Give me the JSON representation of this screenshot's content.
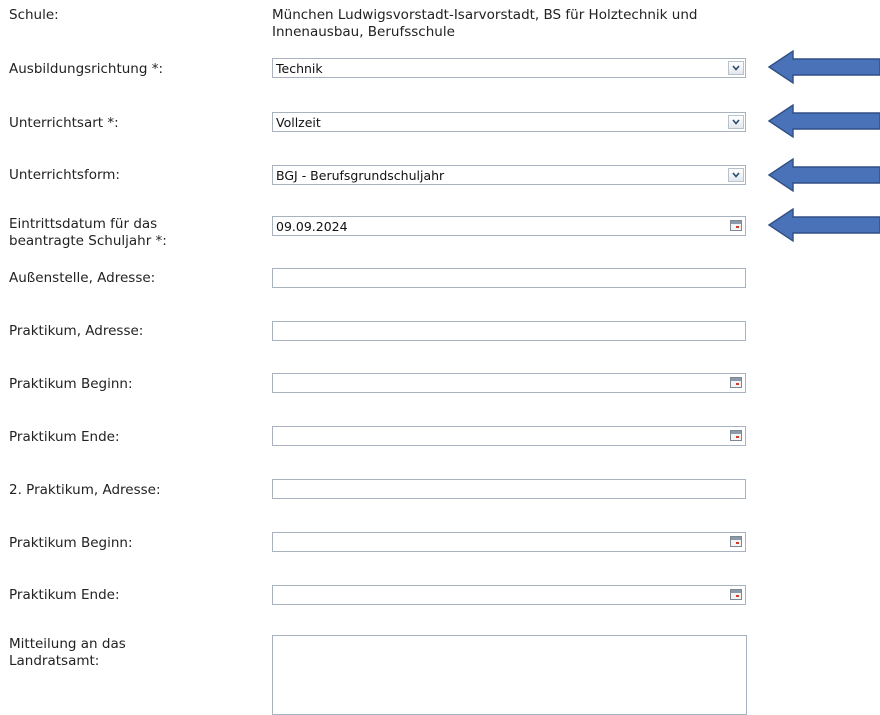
{
  "form": {
    "schule": {
      "label": "Schule:",
      "value_line1": "München Ludwigsvorstadt-Isarvorstadt, BS für Holztechnik und",
      "value_line2": "Innenausbau, Berufsschule"
    },
    "ausbildungsrichtung": {
      "label": "Ausbildungsrichtung *:",
      "value": "Technik",
      "icon": "chevron-down-icon"
    },
    "unterrichtsart": {
      "label": "Unterrichtsart *:",
      "value": "Vollzeit",
      "icon": "chevron-down-icon"
    },
    "unterrichtsform": {
      "label": "Unterrichtsform:",
      "value": "BGJ - Berufsgrundschuljahr",
      "icon": "chevron-down-icon"
    },
    "eintrittsdatum": {
      "label_line1": "Eintrittsdatum für das",
      "label_line2": "beantragte Schuljahr *:",
      "value": "09.09.2024",
      "icon": "calendar-icon"
    },
    "aussenstelle": {
      "label": "Außenstelle, Adresse:",
      "value": ""
    },
    "praktikum_adresse": {
      "label": "Praktikum, Adresse:",
      "value": ""
    },
    "praktikum_beginn": {
      "label": "Praktikum Beginn:",
      "value": "",
      "icon": "calendar-icon"
    },
    "praktikum_ende": {
      "label": "Praktikum Ende:",
      "value": "",
      "icon": "calendar-icon"
    },
    "praktikum2_adresse": {
      "label": "2. Praktikum, Adresse:",
      "value": ""
    },
    "praktikum2_beginn": {
      "label": "Praktikum Beginn:",
      "value": "",
      "icon": "calendar-icon"
    },
    "praktikum2_ende": {
      "label": "Praktikum Ende:",
      "value": "",
      "icon": "calendar-icon"
    },
    "mitteilung": {
      "label_line1": "Mitteilung an das",
      "label_line2": "Landratsamt:",
      "value": ""
    }
  },
  "annotations": {
    "arrow_color": "#4a72b8",
    "arrow_icon": "arrow-left-icon"
  }
}
